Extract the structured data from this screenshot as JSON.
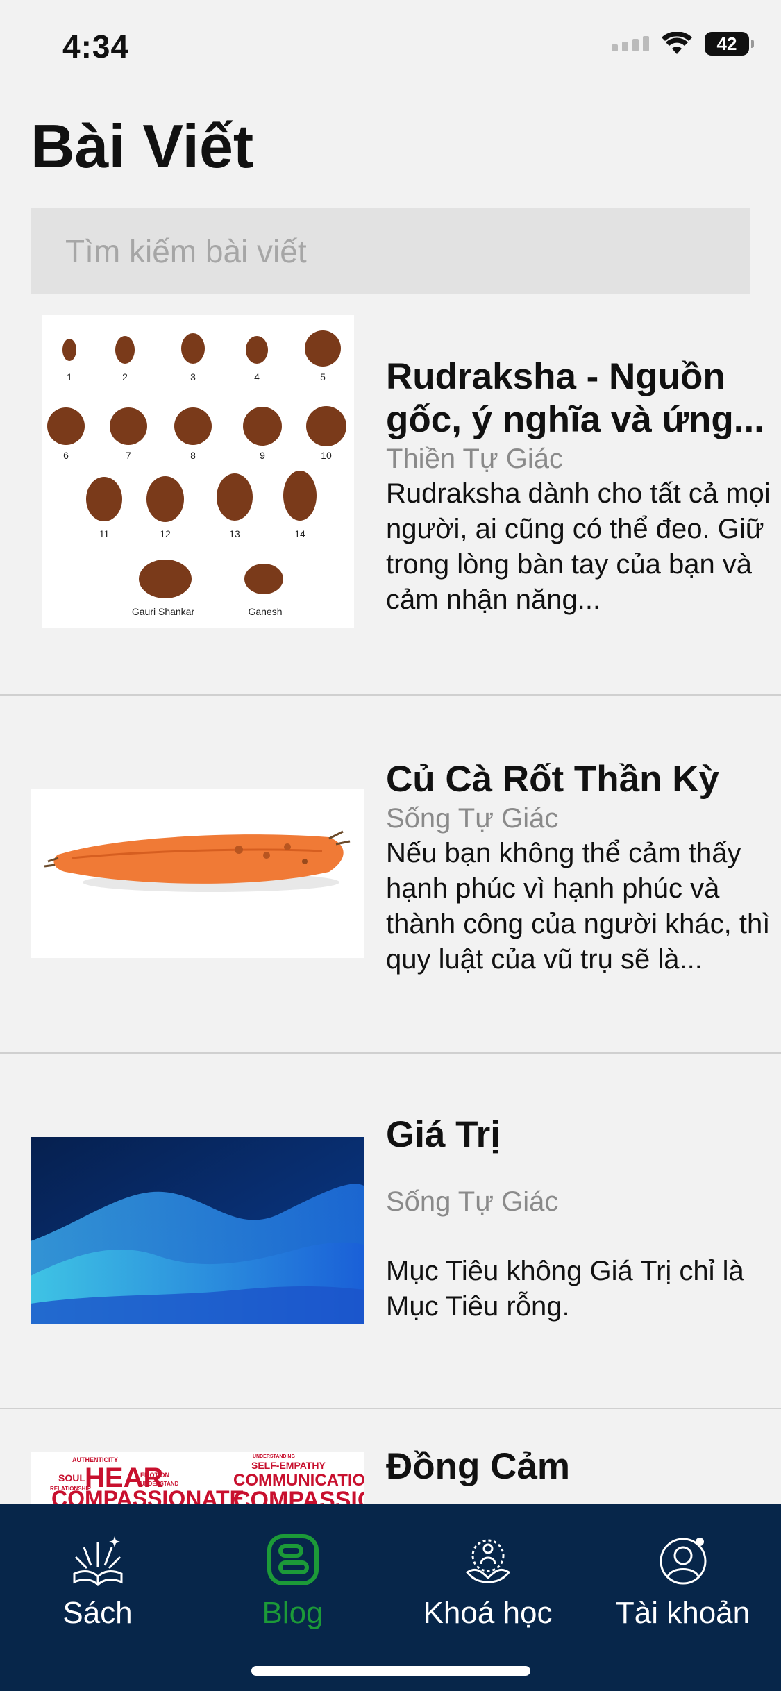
{
  "status": {
    "time": "4:34",
    "battery": "42"
  },
  "page": {
    "title": "Bài Viết"
  },
  "search": {
    "placeholder": "Tìm kiếm bài viết"
  },
  "articles": [
    {
      "title": "Rudraksha - Nguồn gốc, ý nghĩa và ứng...",
      "category": "Thiền Tự Giác",
      "description": "Rudraksha dành cho tất cả mọi người, ai cũng có thể đeo. Giữ trong lòng bàn tay của bạn và cảm nhận năng...",
      "image": "rudraksha-beads",
      "bead_labels": [
        "1",
        "2",
        "3",
        "4",
        "5",
        "6",
        "7",
        "8",
        "9",
        "10",
        "11",
        "12",
        "13",
        "14",
        "Gauri Shankar",
        "Ganesh"
      ]
    },
    {
      "title": "Củ Cà Rốt Thần Kỳ",
      "category": "Sống Tự Giác",
      "description": "Nếu bạn không thể cảm thấy hạnh phúc vì hạnh phúc và thành công của người khác, thì quy luật của vũ trụ sẽ là...",
      "image": "carrot"
    },
    {
      "title": "Giá Trị",
      "category": "Sống Tự Giác",
      "description": "Mục Tiêu không Giá Trị chỉ là Mục Tiêu rỗng.",
      "image": "blue-waves"
    },
    {
      "title": "Đồng Cảm",
      "image": "word-cloud",
      "cloud_words": [
        "AUTHENTICITY",
        "SOUL",
        "RELATIONSHIP",
        "HEAR",
        "EMOTION",
        "UNDERSTAND",
        "COMPASSIONATE",
        "UNDERSTANDING",
        "SELF-EMPATHY",
        "COMMUNICATION",
        "COMPASSION"
      ]
    }
  ],
  "tabs": [
    {
      "label": "Sách",
      "icon": "book-sparkle-icon"
    },
    {
      "label": "Blog",
      "icon": "blog-icon",
      "active": true
    },
    {
      "label": "Khoá học",
      "icon": "lotus-meditation-icon"
    },
    {
      "label": "Tài khoản",
      "icon": "account-icon"
    }
  ],
  "colors": {
    "tabbar": "#07264a",
    "active_tab": "#1c9a38",
    "background": "#f2f2f2"
  }
}
